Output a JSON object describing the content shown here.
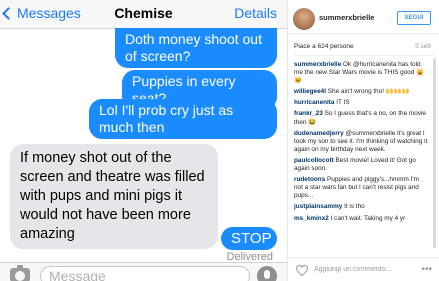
{
  "imessage": {
    "nav": {
      "back_label": "Messages",
      "title": "Chemise",
      "details_label": "Details"
    },
    "messages": [
      {
        "from": "me",
        "text": "Doth money shoot out of screen?"
      },
      {
        "from": "me",
        "text": "Puppies in every seat?"
      },
      {
        "from": "me",
        "text": "Lol I'll prob cry just as much then"
      },
      {
        "from": "them",
        "text": "If money shot out of the screen and theatre was filled with pups and mini pigs it would not have been more amazing"
      },
      {
        "from": "me",
        "text": "STOP"
      }
    ],
    "delivered": "Delivered",
    "input_placeholder": "Message",
    "icons": {
      "camera": "camera-icon",
      "mic": "microphone-icon",
      "back": "chevron-left-icon"
    },
    "colors": {
      "accent": "#1a7cf5",
      "outgoing": "#1a8cff",
      "incoming": "#e6e6ea"
    }
  },
  "instagram": {
    "username": "summerxbrielle",
    "follow_label": "SEGUI",
    "likes": "Piace a 624 persone",
    "date": "5 sett",
    "comments": [
      {
        "user": "summerxbrielle",
        "text": "Ok @hurricanenita has told me the new Star Wars movie is THIS good 🙀🐱"
      },
      {
        "user": "williegee4l",
        "text": "She ain't wrong tho! 🙌🙌🙌"
      },
      {
        "user": "hurricanenita",
        "text": "IT IS"
      },
      {
        "user": "frankr_23",
        "text": "So I guess that's a no, on the movie then 😂"
      },
      {
        "user": "dudenamedjerry",
        "text": "@summerxbrielle it's great I took my son to see it. I'm thinking of watching it again on my birthday next week."
      },
      {
        "user": "paulcollocott",
        "text": "Best movie! Loved it! Got go again soon."
      },
      {
        "user": "rudetoons",
        "text": "Puppies and piggy's...hmmm I'm not a star wars fan but I can't resist pigs and pups..."
      },
      {
        "user": "justplainsammy",
        "text": "It is tho"
      },
      {
        "user": "ms_kminx2",
        "text": "I can't wait. Taking my 4 yr"
      }
    ],
    "add_comment_placeholder": "Aggiungi un commento...",
    "more_label": "•••",
    "icons": {
      "like": "heart-icon",
      "more": "more-dots-icon"
    },
    "colors": {
      "link": "#003569",
      "follow": "#3897f0"
    }
  }
}
